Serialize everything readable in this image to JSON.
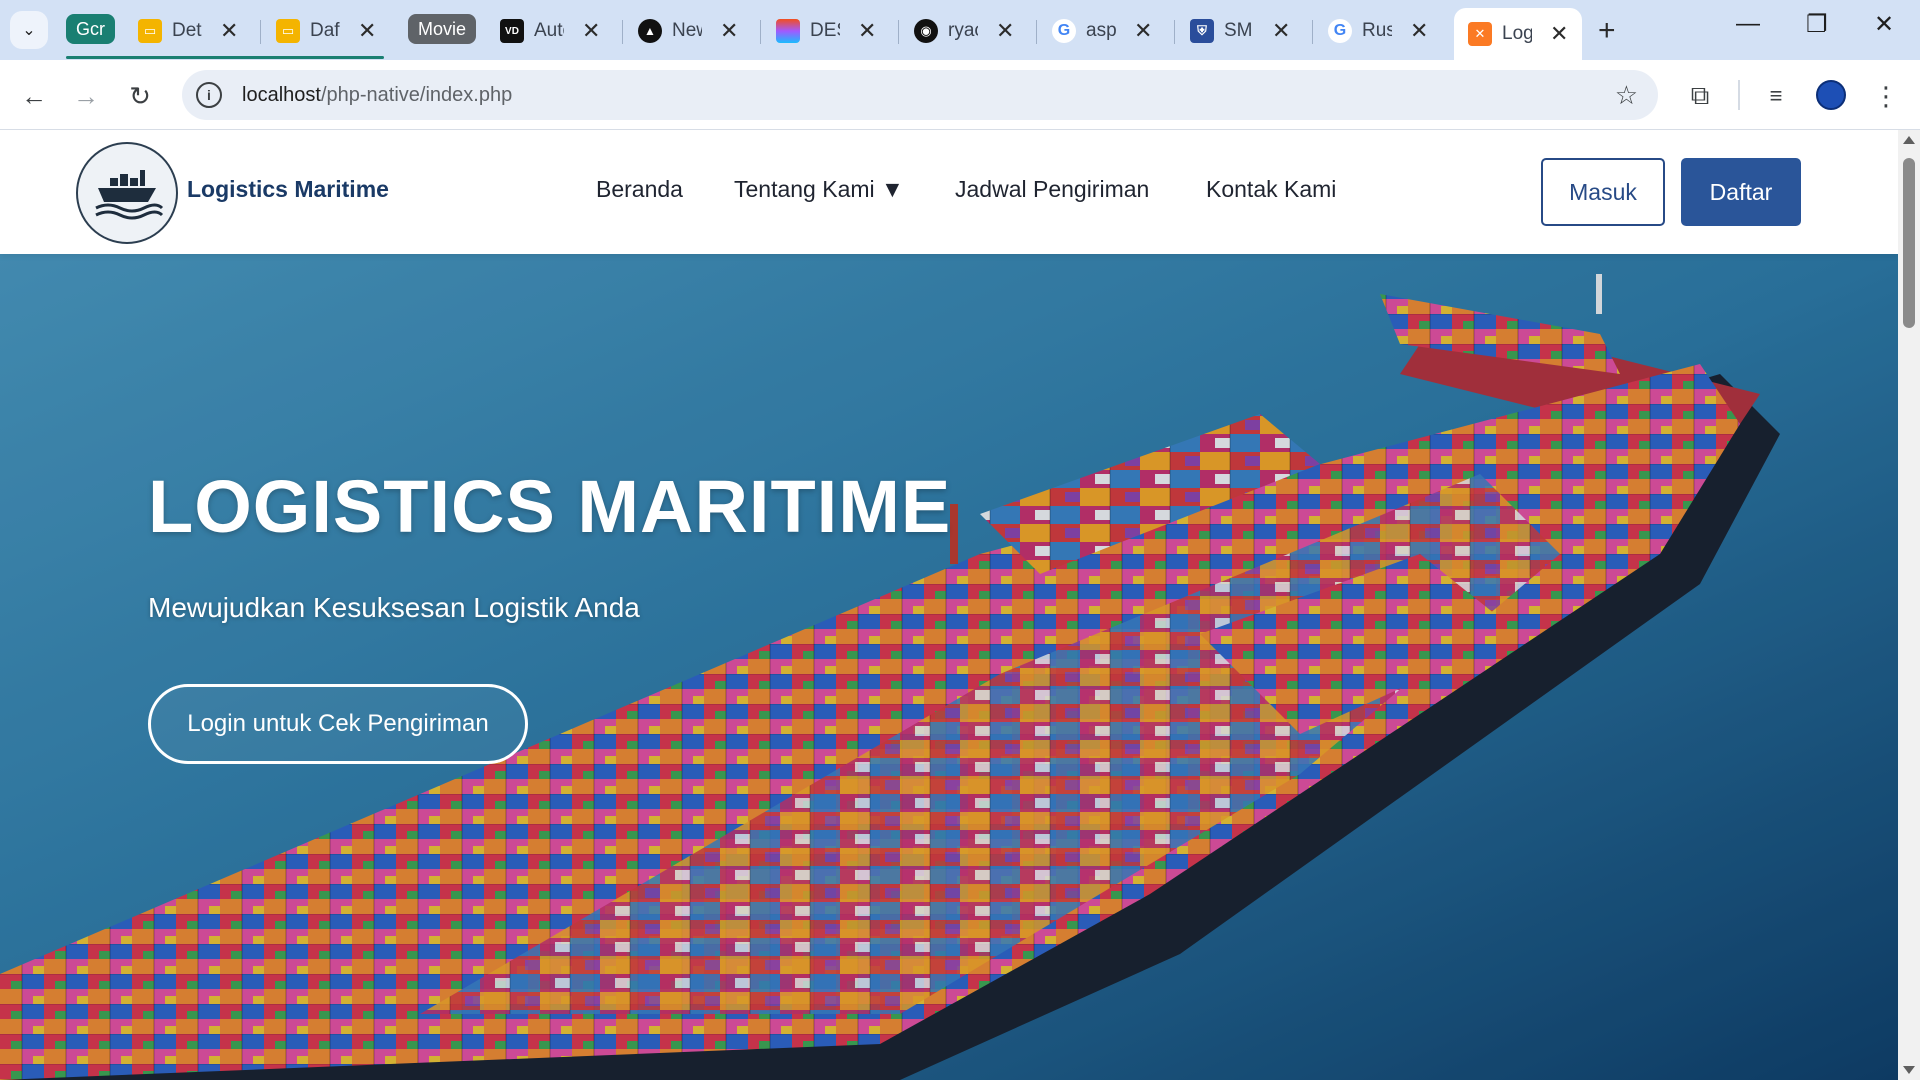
{
  "browser": {
    "tabs": [
      {
        "title": "Det",
        "favicon": "slides-icon",
        "color": "#f4b400"
      },
      {
        "title": "Daft",
        "favicon": "slides-icon",
        "color": "#f4b400"
      },
      {
        "title": "Auto",
        "favicon": "vd-icon",
        "color": "#111111"
      },
      {
        "title": "New",
        "favicon": "triangle-icon",
        "color": "#111111"
      },
      {
        "title": "DES",
        "favicon": "figma-icon",
        "color": "#f24e1e"
      },
      {
        "title": "ryac",
        "favicon": "github-icon",
        "color": "#111111"
      },
      {
        "title": "aspe",
        "favicon": "google-icon",
        "color": "#4285f4"
      },
      {
        "title": "SMK",
        "favicon": "shield-icon",
        "color": "#2a4d9b"
      },
      {
        "title": "Rus",
        "favicon": "google-icon",
        "color": "#4285f4"
      },
      {
        "title": "Log",
        "favicon": "xampp-icon",
        "color": "#fb7a24",
        "active": true
      }
    ],
    "groups": [
      {
        "label": "Gcr",
        "color": "#1a7f72"
      },
      {
        "label": "Movie",
        "color": "#5f6368"
      }
    ],
    "url_host": "localhost",
    "url_path": "/php-native/index.php"
  },
  "site": {
    "brand": "Logistics Maritime",
    "nav": [
      "Beranda",
      "Tentang Kami ▼",
      "Jadwal Pengiriman",
      "Kontak Kami"
    ],
    "login_label": "Masuk",
    "register_label": "Daftar"
  },
  "hero": {
    "title": "LOGISTICS MARITIME",
    "subtitle": "Mewujudkan Kesuksesan Logistik Anda",
    "cta_label": "Login untuk Cek Pengiriman"
  },
  "colors": {
    "brand_blue": "#2a5599",
    "navy_text": "#1a3a66",
    "tab_group_green": "#1a7f72"
  }
}
